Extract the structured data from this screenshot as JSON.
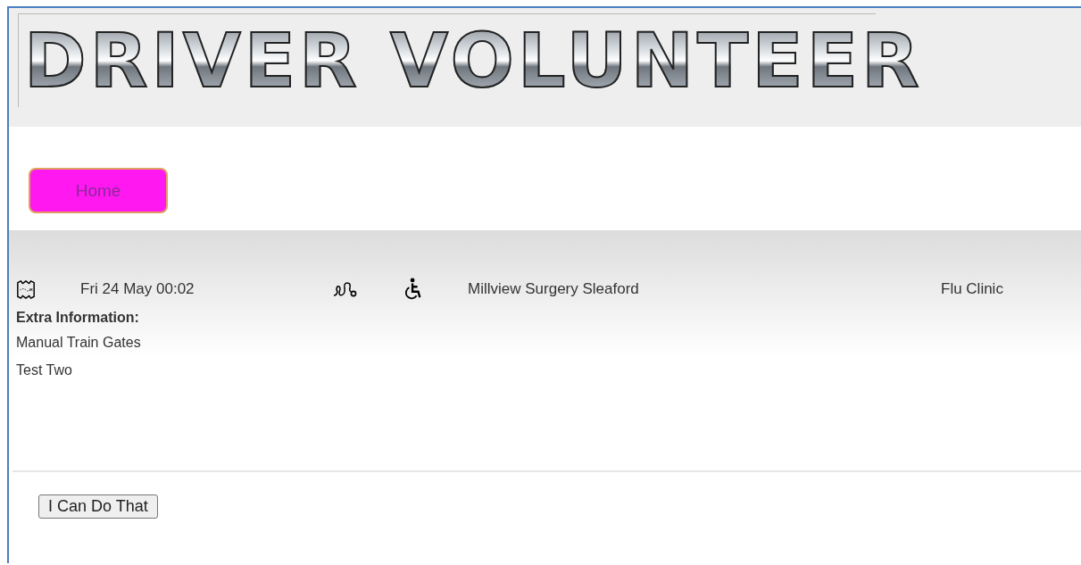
{
  "logo": {
    "title": "DRIVER VOLUNTEER"
  },
  "nav": [
    {
      "label": "Home"
    }
  ],
  "job": {
    "date": "Fri 24 May 00:02",
    "destination": "Millview Surgery Sleaford",
    "purpose": "Flu Clinic",
    "extra_label": "Extra Information:",
    "extra_lines": [
      "Manual Train Gates",
      "Test Two"
    ]
  },
  "actions": [
    {
      "label": "I Can Do That"
    }
  ]
}
